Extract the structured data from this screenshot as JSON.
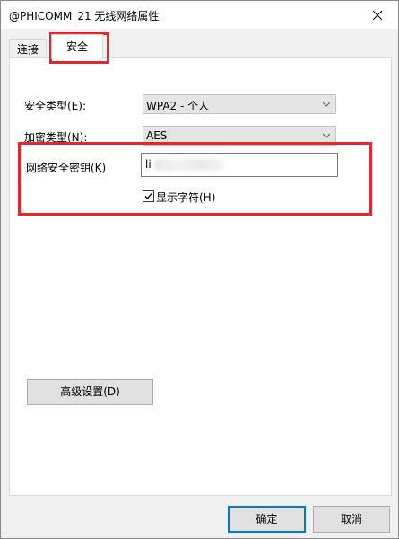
{
  "window": {
    "title": "@PHICOMM_21 无线网络属性",
    "close_glyph": "×"
  },
  "tabs": [
    {
      "label": "连接",
      "active": false
    },
    {
      "label": "安全",
      "active": true
    }
  ],
  "security": {
    "security_type_label": "安全类型(E):",
    "security_type_value": "WPA2 - 个人",
    "encryption_type_label": "加密类型(N):",
    "encryption_type_value": "AES",
    "network_key_label": "网络安全密钥(K)",
    "network_key_value": "li",
    "show_chars_label": "显示字符(H)",
    "show_chars_checked": true
  },
  "advanced_button_label": "高级设置(D)",
  "footer": {
    "ok_label": "确定",
    "cancel_label": "取消"
  },
  "annotation_color": "#e8252b"
}
